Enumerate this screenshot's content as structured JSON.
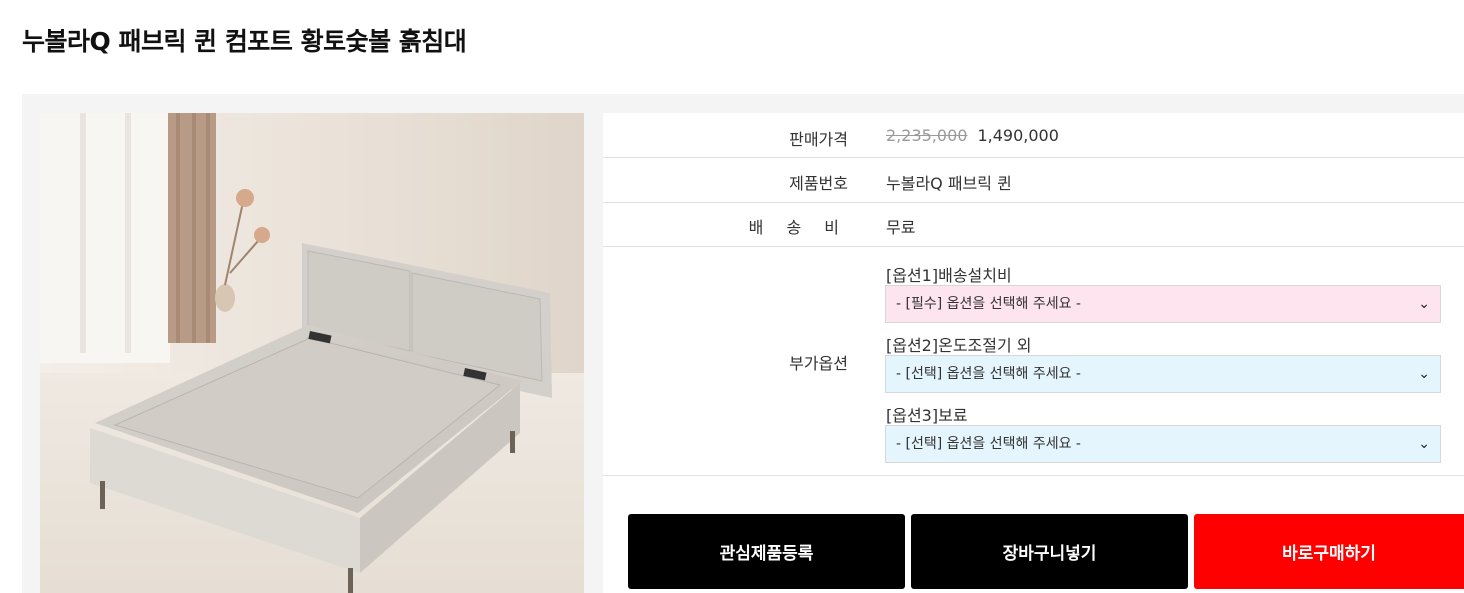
{
  "product": {
    "title": "누볼라Q 패브릭 퀸 컴포트 황토숯볼 흙침대"
  },
  "info": {
    "price_label": "판매가격",
    "original_price": "2,235,000",
    "sale_price": "1,490,000",
    "code_label": "제품번호",
    "code_value": "누볼라Q 패브릭 퀸",
    "shipping_label": "배 송 비",
    "shipping_value": "무료",
    "options_label": "부가옵션"
  },
  "options": [
    {
      "label": "[옵션1]배송설치비",
      "selected": "- [필수] 옵션을 선택해 주세요 -"
    },
    {
      "label": "[옵션2]온도조절기 외",
      "selected": "- [선택] 옵션을 선택해 주세요 -"
    },
    {
      "label": "[옵션3]보료",
      "selected": "- [선택] 옵션을 선택해 주세요 -"
    }
  ],
  "buttons": {
    "wishlist": "관심제품등록",
    "cart": "장바구니넣기",
    "buy": "바로구매하기"
  },
  "colors": {
    "buy_button": "#ff0000",
    "action_button": "#000000",
    "required_select_bg": "#fde4ef",
    "optional_select_bg": "#e4f5fd"
  },
  "icons": {
    "select_arrow": "chevron-down-icon"
  }
}
